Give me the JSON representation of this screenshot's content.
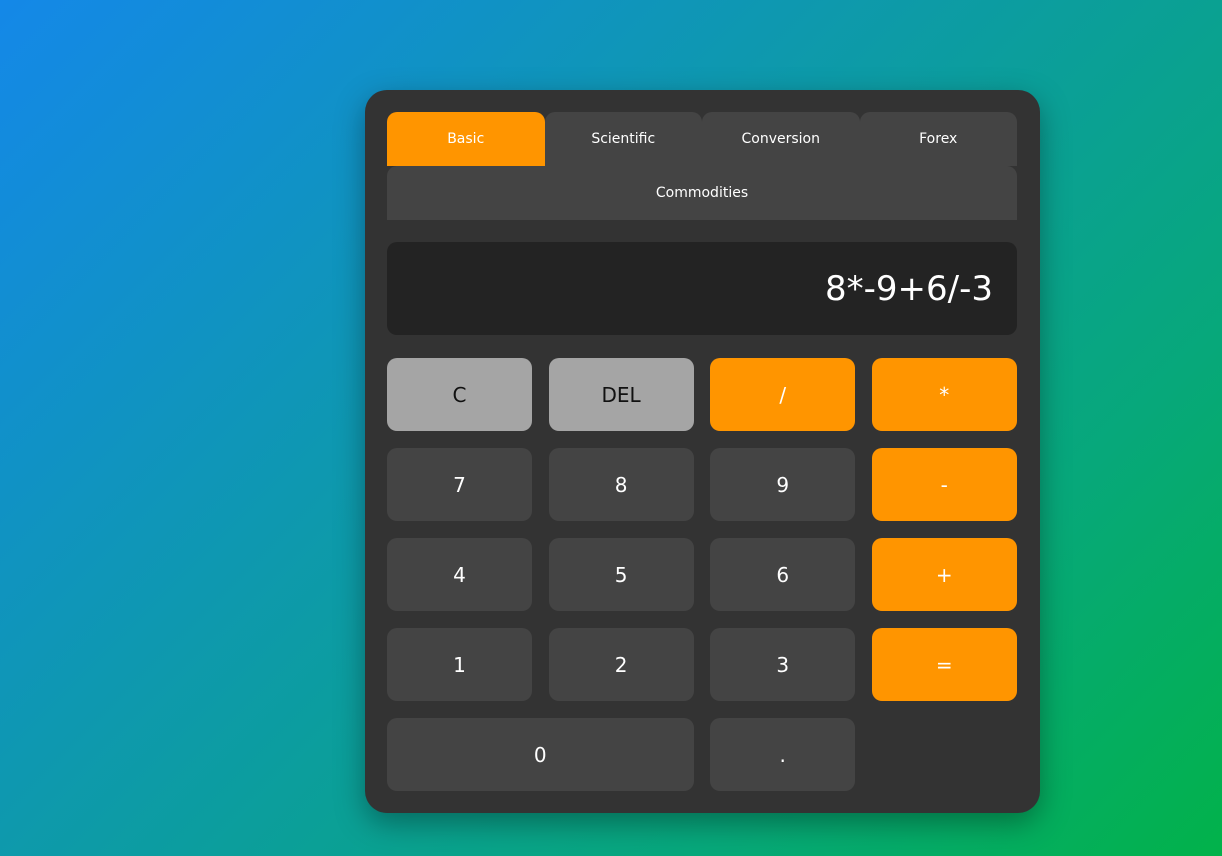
{
  "tabs": {
    "row1": [
      "Basic",
      "Scientific",
      "Conversion",
      "Forex"
    ],
    "row2": "Commodities",
    "active": "Basic"
  },
  "display": {
    "expression": "8*-9+6/-3"
  },
  "keys": {
    "clear": "C",
    "delete": "DEL",
    "divide": "/",
    "multiply": "*",
    "seven": "7",
    "eight": "8",
    "nine": "9",
    "minus": "-",
    "four": "4",
    "five": "5",
    "six": "6",
    "plus": "+",
    "one": "1",
    "two": "2",
    "three": "3",
    "equals": "=",
    "zero": "0",
    "decimal": "."
  },
  "colors": {
    "accent": "#ff9500",
    "panel": "#333333",
    "key": "#444444",
    "function_key": "#a5a5a5",
    "display": "#232323"
  }
}
